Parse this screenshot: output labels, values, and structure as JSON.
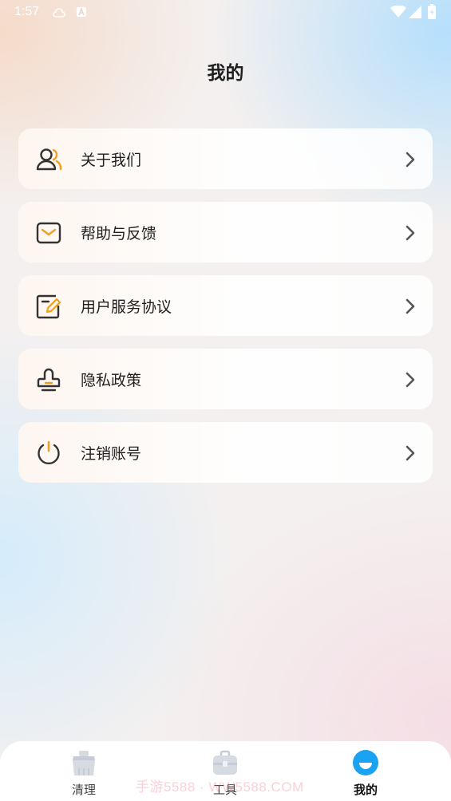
{
  "status_bar": {
    "time": "1:57",
    "icons": [
      "cloud-icon",
      "a-icon",
      "wifi-icon",
      "signal-icon",
      "battery-icon"
    ]
  },
  "page": {
    "title": "我的"
  },
  "menu": {
    "items": [
      {
        "label": "关于我们",
        "icon": "about-us-icon"
      },
      {
        "label": "帮助与反馈",
        "icon": "mail-icon"
      },
      {
        "label": "用户服务协议",
        "icon": "agreement-edit-icon"
      },
      {
        "label": "隐私政策",
        "icon": "privacy-stamp-icon"
      },
      {
        "label": "注销账号",
        "icon": "power-icon"
      }
    ]
  },
  "tabbar": {
    "tabs": [
      {
        "label": "清理",
        "icon": "broom-icon",
        "active": false
      },
      {
        "label": "工具",
        "icon": "toolbox-icon",
        "active": false
      },
      {
        "label": "我的",
        "icon": "profile-face-icon",
        "active": true
      }
    ]
  },
  "watermark": "手游5588 · WW5588.COM",
  "colors": {
    "accent": "#1aa3f0",
    "icon_orange": "#f0a020",
    "icon_dark": "#333333",
    "chevron": "#555555"
  }
}
